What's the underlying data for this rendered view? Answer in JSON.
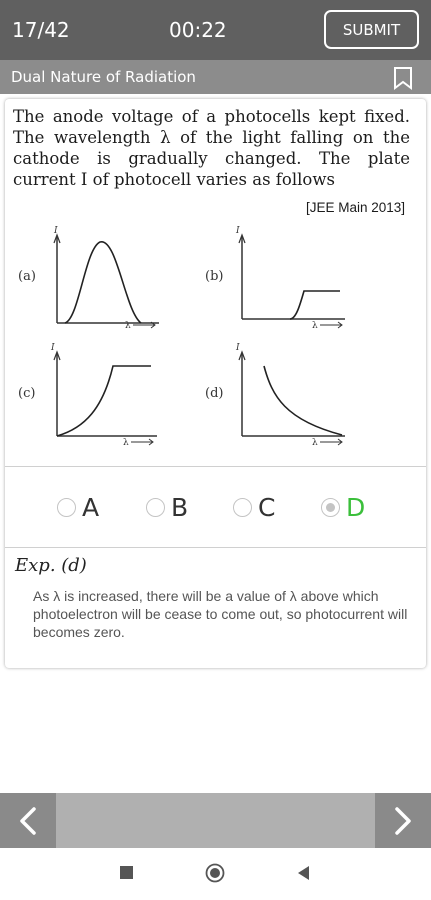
{
  "header": {
    "counter": "17/42",
    "timer": "00:22",
    "submit_label": "SUBMIT"
  },
  "subheader": {
    "topic": "Dual Nature of Radiation"
  },
  "question": {
    "text": "The anode voltage of a photocells kept fixed. The wavelength λ of the light falling on the cathode is gradually changed. The plate current I of photocell varies as follows",
    "source": "[JEE Main 2013]",
    "graphs": [
      {
        "label": "(a)",
        "y_axis": "I",
        "x_axis": "λ"
      },
      {
        "label": "(b)",
        "y_axis": "I",
        "x_axis": "λ"
      },
      {
        "label": "(c)",
        "y_axis": "I",
        "x_axis": "λ"
      },
      {
        "label": "(d)",
        "y_axis": "I",
        "x_axis": "λ"
      }
    ]
  },
  "options": [
    {
      "label": "A",
      "selected": false
    },
    {
      "label": "B",
      "selected": false
    },
    {
      "label": "C",
      "selected": false
    },
    {
      "label": "D",
      "selected": true
    }
  ],
  "explanation": {
    "title": "Exp. (d)",
    "text": "As λ is increased, there will be a value of λ above which photoelectron will be cease to come out, so photocurrent will becomes zero."
  },
  "colors": {
    "correct": "#3bbf3b",
    "topbar": "#606060",
    "subbar": "#8c8c8c"
  },
  "icons": {
    "bookmark": "bookmark-icon",
    "prev": "chevron-left-icon",
    "next": "chevron-right-icon"
  }
}
